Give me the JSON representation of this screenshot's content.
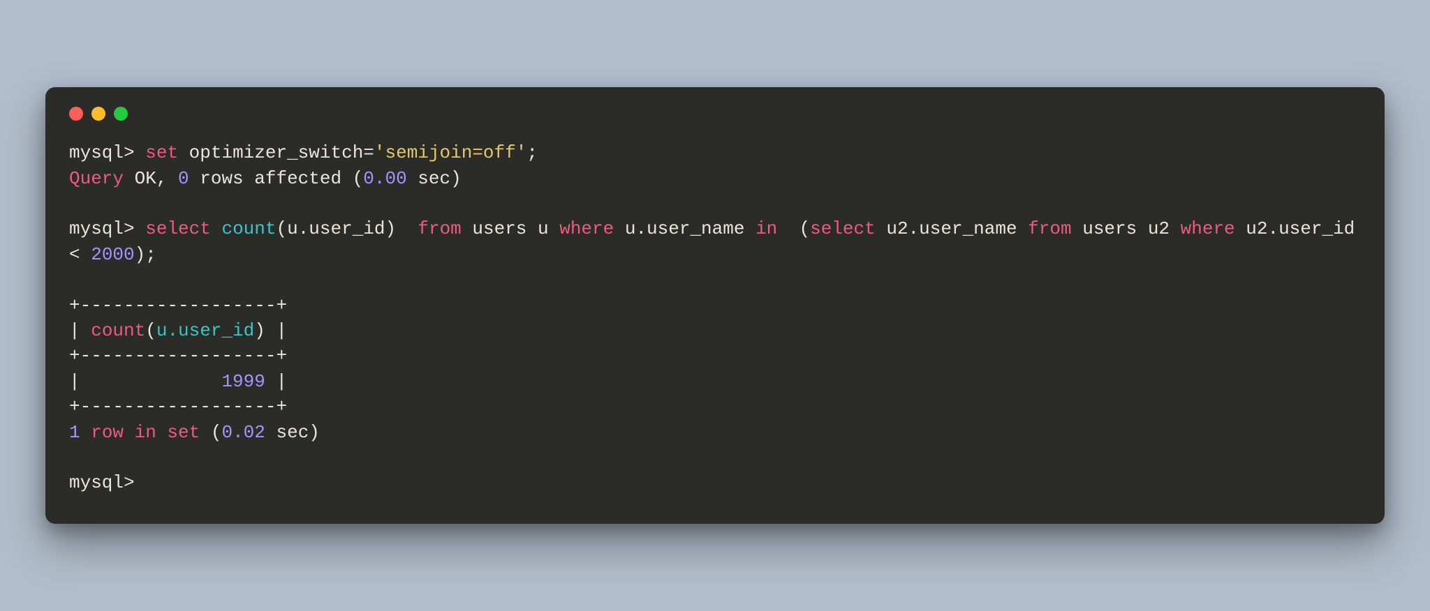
{
  "window": {
    "light_red": "close",
    "light_yellow": "minimize",
    "light_green": "zoom"
  },
  "prompt": "mysql>",
  "tokens": {
    "set": "set",
    "optimizer_switch": "optimizer_switch",
    "eq": "=",
    "semijoin_off": "'semijoin=off'",
    "semi": ";",
    "query": "Query",
    "ok_comma": " OK, ",
    "zero": "0",
    "rows_affected": " rows affected (",
    "time_000": "0.00",
    "sec_close": " sec)",
    "select": "select",
    "count": "count",
    "lp": "(",
    "u_user_id": "u.user_id",
    "rp": ")",
    "from": "from",
    "users_u": " users u ",
    "where": "where",
    "u_user_name": " u.user_name ",
    "in": "in",
    "select2": "select",
    "u2_user_name": " u2.user_name ",
    "from2": "from",
    "users_u2": " users u2 ",
    "where2": "where",
    "u2_user_id": " u2.user_id ",
    "lt": "<",
    "two_thousand": " 2000",
    "rp_semi": ");",
    "border": "+------------------+",
    "row_header_pre": "| ",
    "row_header_label": "count(u.user_id)",
    "row_header_post": " |",
    "row_value_pre": "|             ",
    "row_value": "1999",
    "row_value_post": " |",
    "one": "1",
    "row_in_set": " row in set",
    "open_paren": " (",
    "time_002": "0.02",
    "sec_close2": " sec)"
  }
}
